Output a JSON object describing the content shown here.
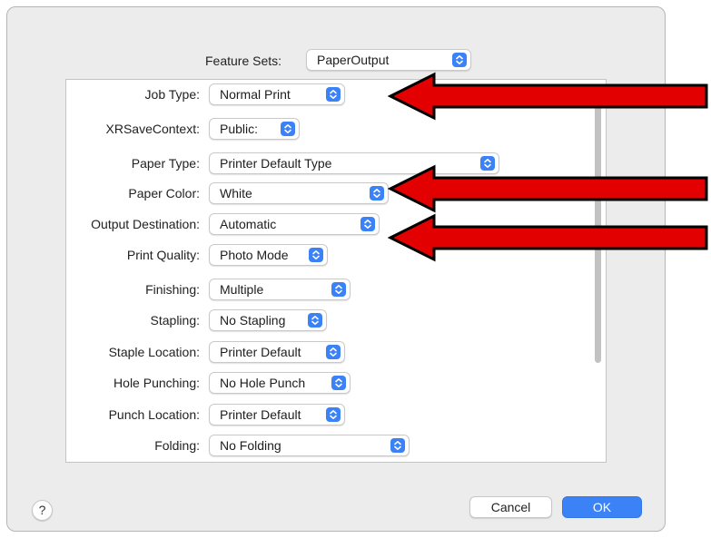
{
  "dialog": {
    "feature_sets_label": "Feature Sets:",
    "feature_sets_value": "PaperOutput",
    "rows": [
      {
        "label": "Job Type:",
        "value": "Normal Print"
      },
      {
        "label": "XRSaveContext:",
        "value": "Public:"
      },
      {
        "label": "Paper Type:",
        "value": "Printer Default Type"
      },
      {
        "label": "Paper Color:",
        "value": "White"
      },
      {
        "label": "Output Destination:",
        "value": "Automatic"
      },
      {
        "label": "Print Quality:",
        "value": "Photo Mode"
      },
      {
        "label": "Finishing:",
        "value": "Multiple"
      },
      {
        "label": "Stapling:",
        "value": "No Stapling"
      },
      {
        "label": "Staple Location:",
        "value": "Printer Default"
      },
      {
        "label": "Hole Punching:",
        "value": "No Hole Punch"
      },
      {
        "label": "Punch Location:",
        "value": "Printer Default"
      },
      {
        "label": "Folding:",
        "value": "No Folding"
      }
    ],
    "help_label": "?",
    "cancel_label": "Cancel",
    "ok_label": "OK"
  },
  "colors": {
    "accent": "#3b82f7",
    "arrow_fill": "#e30000",
    "dialog_bg": "#ececec"
  },
  "icons": {
    "popup_indicator": "chevron-up-down-icon",
    "annotation": "arrow-left-icon"
  }
}
